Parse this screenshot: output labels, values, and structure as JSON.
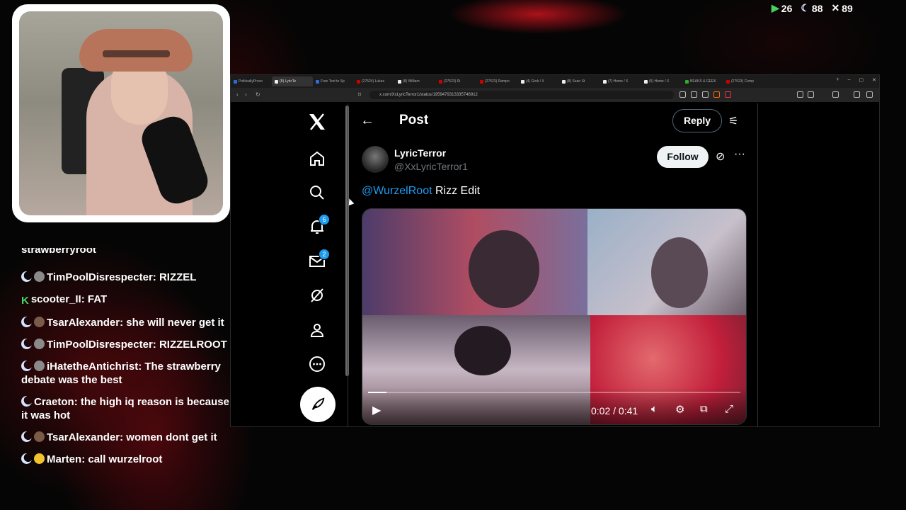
{
  "stream": {
    "stats": [
      {
        "icon": "play-icon",
        "value": "26",
        "color": "#46d160"
      },
      {
        "icon": "moon-icon",
        "value": "88",
        "color": "#d6e4ff"
      },
      {
        "icon": "x-icon",
        "value": "89",
        "color": "#ffffff"
      }
    ]
  },
  "chat": {
    "cut_off_line": "strawberryroot",
    "messages": [
      {
        "badges": [
          "moon",
          "sloth"
        ],
        "user": "TimPoolDisrespecter",
        "text": "RIZZEL"
      },
      {
        "badges": [
          "kick"
        ],
        "user": "scooter_II",
        "text": "FAT"
      },
      {
        "badges": [
          "moon",
          "user"
        ],
        "user": "TsarAlexander",
        "text": "she will never get it"
      },
      {
        "badges": [
          "moon",
          "sloth"
        ],
        "user": "TimPoolDisrespecter",
        "text": "RIZZELROOT"
      },
      {
        "badges": [
          "moon",
          "globe"
        ],
        "user": "iHatetheAntichrist",
        "text": "The strawberry debate was the best"
      },
      {
        "badges": [
          "moon"
        ],
        "user": "Craeton",
        "text": "the high iq reason is because it was hot"
      },
      {
        "badges": [
          "moon",
          "user"
        ],
        "user": "TsarAlexander",
        "text": "women dont get it"
      },
      {
        "badges": [
          "moon",
          "smile"
        ],
        "user": "Marten",
        "text": "call wurzelroot"
      }
    ]
  },
  "browser": {
    "tabs": [
      {
        "label": "PoliticallyProvo",
        "color": "b",
        "active": false
      },
      {
        "label": "(8) LyricTe",
        "color": "x",
        "active": true
      },
      {
        "label": "Free Text to Sp",
        "color": "b",
        "active": false
      },
      {
        "label": "(27524) Lukas",
        "color": "r",
        "active": false
      },
      {
        "label": "(8) William",
        "color": "x",
        "active": false
      },
      {
        "label": "(27523) Ri",
        "color": "r",
        "active": false
      },
      {
        "label": "(27523) Rampo",
        "color": "r",
        "active": false
      },
      {
        "label": "(4) Grok / X",
        "color": "x",
        "active": false
      },
      {
        "label": "(8) Sean St",
        "color": "x",
        "active": false
      },
      {
        "label": "(7) Home / X",
        "color": "x",
        "active": false
      },
      {
        "label": "(5) Home / X",
        "color": "x",
        "active": false
      },
      {
        "label": "BEAKS & GEEK",
        "color": "g",
        "active": false
      },
      {
        "label": "(27523) Comp",
        "color": "r",
        "active": false
      }
    ],
    "url": "x.com/XxLyricTerror1/status/1959479313335746912"
  },
  "x": {
    "nav": {
      "notifications_count": "6",
      "messages_count": "2"
    },
    "header": {
      "title": "Post",
      "reply_label": "Reply"
    },
    "post": {
      "display_name": "LyricTerror",
      "handle": "@XxLyricTerror1",
      "follow_label": "Follow",
      "mention": "@WurzelRoot",
      "text": " Rizz Edit"
    },
    "video": {
      "time": "0:02 / 0:41",
      "progress": 0.05
    }
  }
}
